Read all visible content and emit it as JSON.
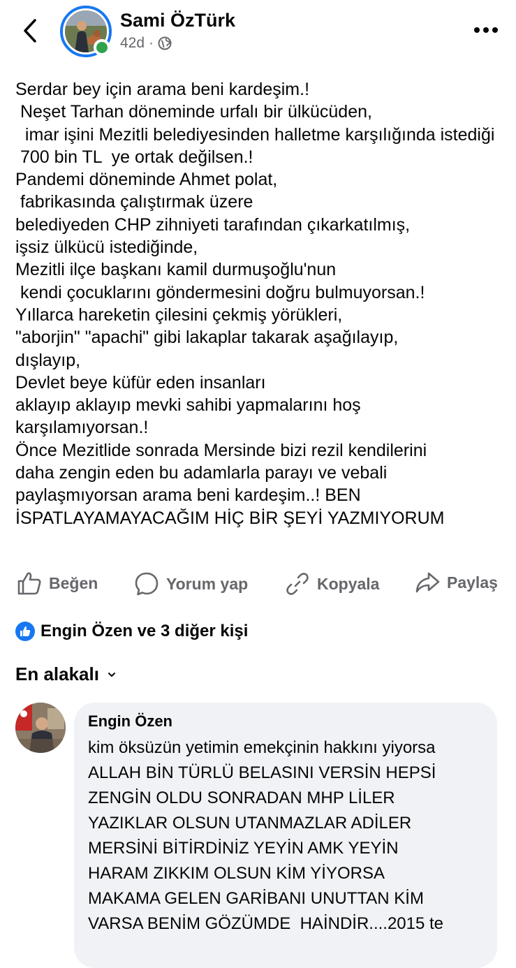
{
  "post": {
    "author": "Sami ÖzTürk",
    "time": "42d",
    "separator": "·",
    "text": "Serdar bey için arama beni kardeşim.!\n Neşet Tarhan döneminde urfalı bir ülkücüden,\n  imar işini Mezitli belediyesinden halletme karşılığında istediği\n 700 bin TL  ye ortak değilsen.!\nPandemi döneminde Ahmet polat,\n fabrikasında çalıştırmak üzere\nbelediyeden CHP zihniyeti tarafından çıkarkatılmış,\nişsiz ülkücü istediğinde,\nMezitli ilçe başkanı kamil durmuşoğlu'nun\n kendi çocuklarını göndermesini doğru bulmuyorsan.!\nYıllarca hareketin çilesini çekmiş yörükleri,\n\"aborjin\" \"apachi\" gibi lakaplar takarak aşağılayıp,\ndışlayıp,\nDevlet beye küfür eden insanları\naklayıp aklayıp mevki sahibi yapmalarını hoş\nkarşılamıyorsan.!\nÖnce Mezitlide sonrada Mersinde bizi rezil kendilerini\ndaha zengin eden bu adamlarla parayı ve vebali\npaylaşmıyorsan arama beni kardeşim..! BEN\nİSPATLAYAMAYACAĞIM HİÇ BİR ŞEYİ YAZMIYORUM"
  },
  "actions": {
    "like": "Beğen",
    "comment": "Yorum yap",
    "copy": "Kopyala",
    "share": "Paylaş"
  },
  "reactions": {
    "summary": "Engin Özen ve 3 diğer kişi"
  },
  "comments_sort": {
    "label": "En alakalı"
  },
  "comment": {
    "author": "Engin Özen",
    "text": "kim öksüzün yetimin emekçinin hakkını yiyorsa\nALLAH BİN TÜRLÜ BELASINI VERSİN HEPSİ\nZENGİN OLDU SONRADAN MHP LİLER\nYAZIKLAR OLSUN UTANMAZLAR ADİLER\nMERSİNİ BİTİRDİNİZ YEYİN AMK YEYİN\nHARAM ZIKKIM OLSUN KİM YİYORSA\nMAKAMA GELEN GARİBANI UNUTTAN KİM\nVARSA BENİM GÖZÜMDE  HAİNDİR....2015 te"
  },
  "colors": {
    "accent": "#1877f2",
    "online": "#31a24c",
    "secondary_text": "#65676b",
    "bubble": "#f0f2f5"
  },
  "icons": [
    "back-arrow-icon",
    "globe-icon",
    "more-options-icon",
    "like-icon",
    "comment-icon",
    "copy-link-icon",
    "share-icon",
    "like-badge-icon",
    "chevron-down-icon"
  ]
}
